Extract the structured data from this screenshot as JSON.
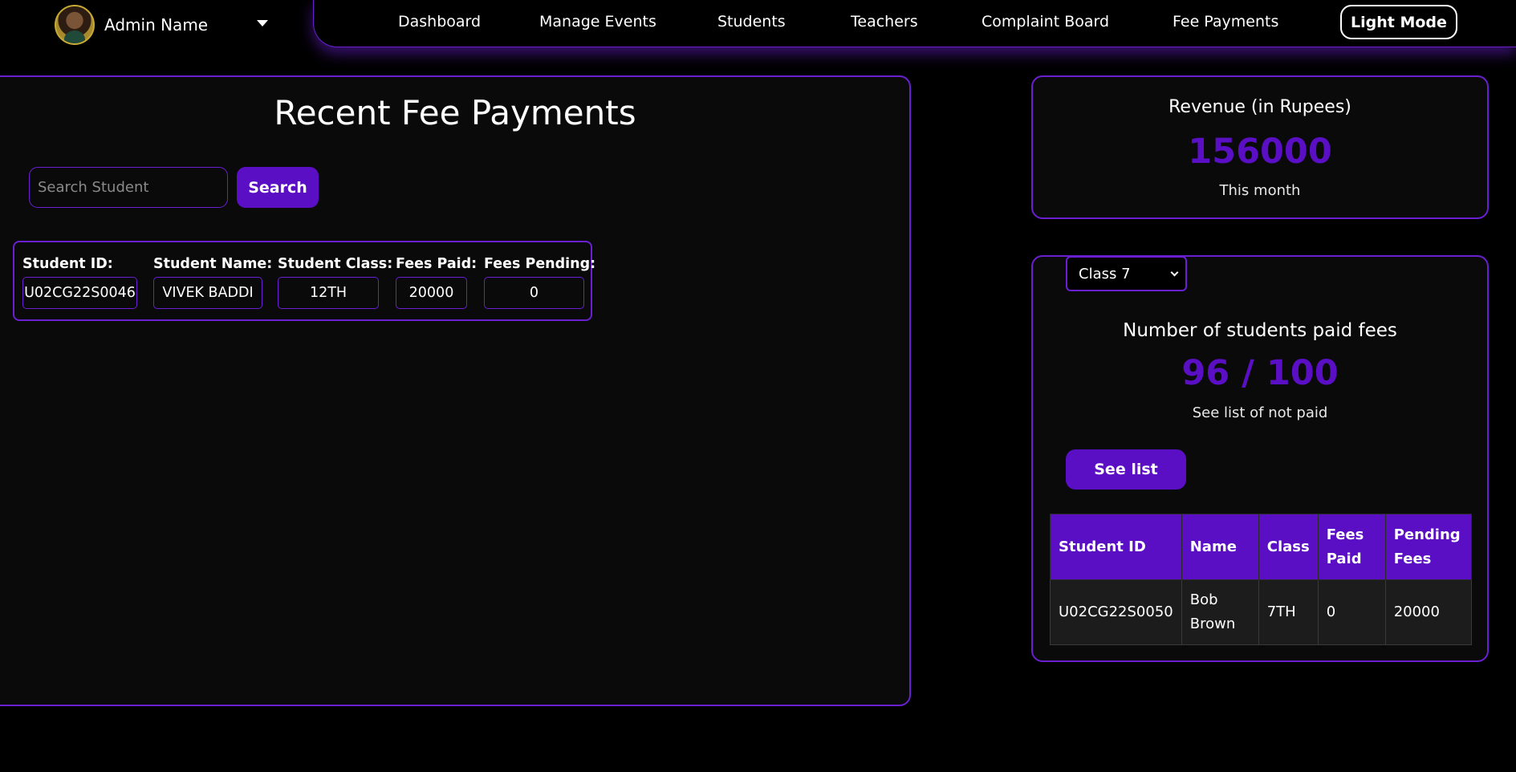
{
  "header": {
    "admin_name": "Admin Name",
    "nav": [
      "Dashboard",
      "Manage Events",
      "Students",
      "Teachers",
      "Complaint Board",
      "Fee Payments"
    ],
    "mode_button": "Light Mode"
  },
  "recent_payments": {
    "title": "Recent Fee Payments",
    "search_placeholder": "Search Student",
    "search_button": "Search",
    "card": {
      "labels": [
        "Student ID:",
        "Student Name:",
        "Student Class:",
        "Fees Paid:",
        "Fees Pending:"
      ],
      "values": [
        "U02CG22S0046",
        "VIVEK BADDI",
        "12TH",
        "20000",
        "0"
      ]
    }
  },
  "revenue": {
    "title": "Revenue (in Rupees)",
    "value": "156000",
    "subtitle": "This month"
  },
  "class_stats": {
    "selected_class": "Class 7",
    "title": "Number of students paid fees",
    "count": "96 / 100",
    "subtitle": "See list of not paid",
    "button": "See list",
    "table": {
      "headers": [
        "Student ID",
        "Name",
        "Class",
        "Fees Paid",
        "Pending Fees"
      ],
      "rows": [
        [
          "U02CG22S0050",
          "Bob Brown",
          "7TH",
          "0",
          "20000"
        ]
      ]
    }
  },
  "colors": {
    "accent": "#5b0fc4",
    "border": "#6a1fd1",
    "background": "#000000"
  }
}
